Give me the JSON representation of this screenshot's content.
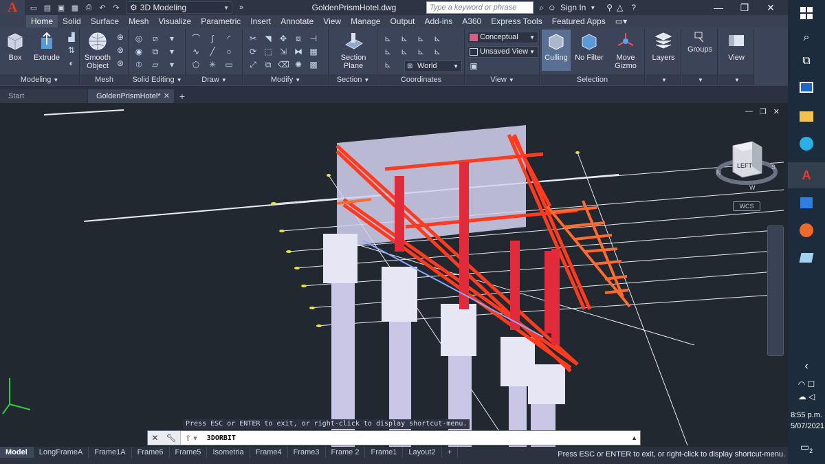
{
  "titlebar": {
    "workspace": "3D Modeling",
    "document": "GoldenPrismHotel.dwg",
    "search_placeholder": "Type a keyword or phrase",
    "signin": "Sign In"
  },
  "ribbon_tabs": [
    "Home",
    "Solid",
    "Surface",
    "Mesh",
    "Visualize",
    "Parametric",
    "Insert",
    "Annotate",
    "View",
    "Manage",
    "Output",
    "Add-ins",
    "A360",
    "Express Tools",
    "Featured Apps"
  ],
  "ribbon": {
    "modeling": {
      "title": "Modeling",
      "box": "Box",
      "extrude": "Extrude"
    },
    "mesh": {
      "title": "Mesh",
      "smooth": "Smooth",
      "object": "Object"
    },
    "solid_editing": {
      "title": "Solid Editing"
    },
    "draw": {
      "title": "Draw"
    },
    "modify": {
      "title": "Modify"
    },
    "section": {
      "title": "Section",
      "plane1": "Section",
      "plane2": "Plane"
    },
    "coordinates": {
      "title": "Coordinates",
      "ucs": "World"
    },
    "view": {
      "title": "View",
      "visual_style": "Conceptual",
      "saved_view": "Unsaved View"
    },
    "selection": {
      "title": "Selection",
      "culling": "Culling",
      "filter": "No Filter",
      "gizmo1": "Move",
      "gizmo2": "Gizmo"
    },
    "layers": "Layers",
    "groups": "Groups",
    "view_btn": "View"
  },
  "doc_tabs": {
    "start": "Start",
    "active": "GoldenPrismHotel*"
  },
  "viewcube": {
    "face": "LEFT",
    "wcs": "WCS",
    "compass_w": "W",
    "compass_s": "S",
    "compass_n": "N"
  },
  "command": {
    "hint": "Press ESC or ENTER to exit, or right-click to display shortcut-menu.",
    "current": "3DORBIT"
  },
  "layout_tabs": [
    "Model",
    "LongFrameA",
    "Frame1A",
    "Frame6",
    "Frame5",
    "Isometria",
    "Frame4",
    "Frame3",
    "Frame 2",
    "Frame1",
    "Layout2"
  ],
  "status_message": "Press ESC or ENTER to exit, or right-click to display shortcut-menu.",
  "clock": {
    "time": "8:55 p.m.",
    "date": "5/07/2021"
  },
  "notification_count": "2",
  "colors": {
    "ribbon": "#3b4458",
    "viewport": "#212830",
    "accent": "#e23a2e",
    "columns": "#c9c6e6",
    "frames": "#ff3b1f"
  }
}
